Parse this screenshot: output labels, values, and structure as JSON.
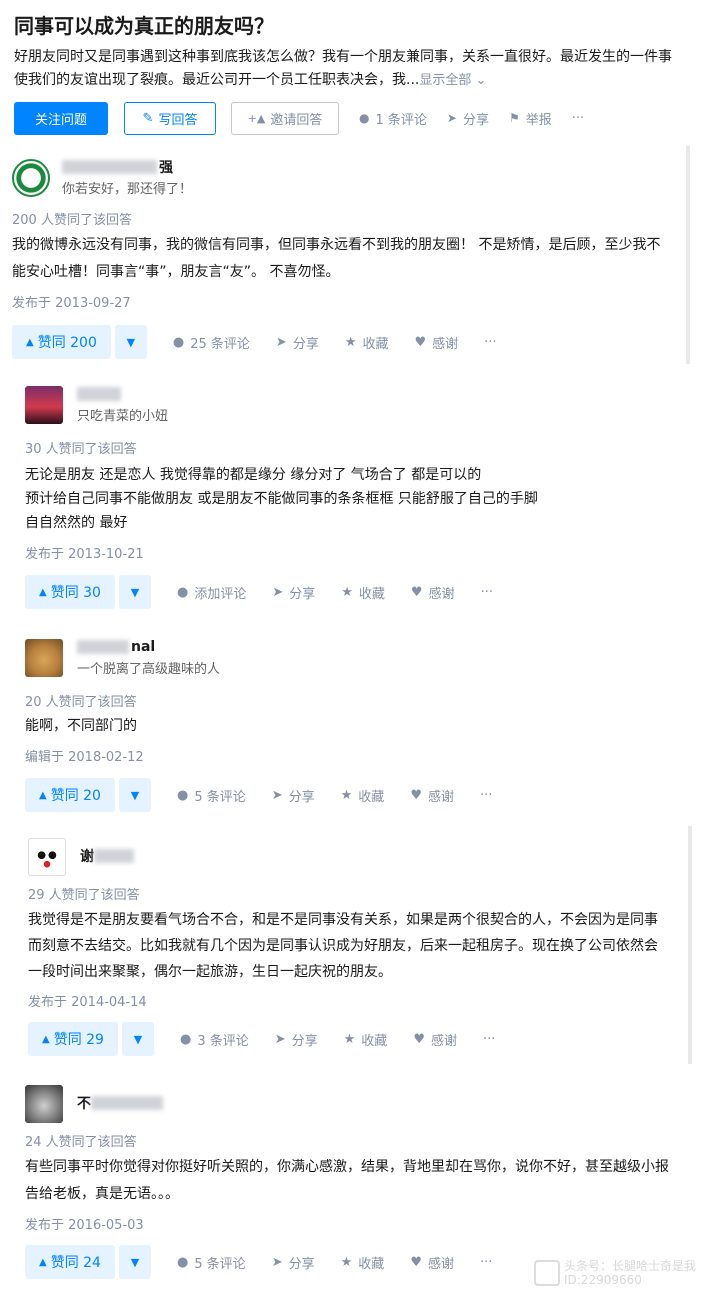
{
  "question": {
    "title": "同事可以成为真正的朋友吗？",
    "detail": "好朋友同时又是同事遇到这种事到底我该怎么做？我有一个朋友兼同事，关系一直很好。最近发生的一件事使我们的友谊出现了裂痕。最近公司开一个员工任职表决会，我...",
    "show_all": "显示全部 ⌄",
    "follow_label": "关注问题",
    "write_label": "写回答",
    "invite_label": "邀请回答",
    "comment_label": "1 条评论",
    "share_label": "分享",
    "report_label": "举报",
    "more_label": "···"
  },
  "answers": [
    {
      "name_visible": "强",
      "bio": "你若安好，那还得了！",
      "votes_text": "200 人赞同了该回答",
      "content": [
        "我的微博永远没有同事，我的微信有同事，但同事永远看不到我的朋友圈！ 不是矫情，是后顾，至少我不能安心吐槽！同事言“事”，朋友言“友”。 不喜勿怪。"
      ],
      "date": "发布于 2013-09-27",
      "vote_label": "赞同 200",
      "comment_label": "25 条评论",
      "share_label": "分享",
      "fav_label": "收藏",
      "thanks_label": "感谢",
      "more_label": "···"
    },
    {
      "name_visible": "",
      "bio": "只吃青菜的小妞",
      "votes_text": "30 人赞同了该回答",
      "content": [
        "无论是朋友 还是恋人 我觉得靠的都是缘分 缘分对了 气场合了 都是可以的",
        "预计给自己同事不能做朋友 或是朋友不能做同事的条条框框 只能舒服了自己的手脚",
        "自自然然的 最好"
      ],
      "date": "发布于 2013-10-21",
      "vote_label": "赞同 30",
      "comment_label": "添加评论",
      "share_label": "分享",
      "fav_label": "收藏",
      "thanks_label": "感谢",
      "more_label": "···"
    },
    {
      "name_visible": "nal",
      "bio": "一个脱离了高级趣味的人",
      "votes_text": "20 人赞同了该回答",
      "content": [
        "能啊，不同部门的"
      ],
      "date": "编辑于 2018-02-12",
      "vote_label": "赞同 20",
      "comment_label": "5 条评论",
      "share_label": "分享",
      "fav_label": "收藏",
      "thanks_label": "感谢",
      "more_label": "···"
    },
    {
      "name_visible": "谢",
      "bio": "",
      "votes_text": "29 人赞同了该回答",
      "content": [
        "我觉得是不是朋友要看气场合不合，和是不是同事没有关系，如果是两个很契合的人，不会因为是同事而刻意不去结交。比如我就有几个因为是同事认识成为好朋友，后来一起租房子。现在换了公司依然会一段时间出来聚聚，偶尔一起旅游，生日一起庆祝的朋友。"
      ],
      "date": "发布于 2014-04-14",
      "vote_label": "赞同 29",
      "comment_label": "3 条评论",
      "share_label": "分享",
      "fav_label": "收藏",
      "thanks_label": "感谢",
      "more_label": "···"
    },
    {
      "name_visible": "不",
      "bio": "",
      "votes_text": "24 人赞同了该回答",
      "content": [
        "有些同事平时你觉得对你挺好听关照的，你满心感激，结果，背地里却在骂你，说你不好，甚至越级小报告给老板，真是无语。。。"
      ],
      "date": "发布于 2016-05-03",
      "vote_label": "赞同 24",
      "comment_label": "5 条评论",
      "share_label": "分享",
      "fav_label": "收藏",
      "thanks_label": "感谢",
      "more_label": "···"
    }
  ],
  "watermark": {
    "line1": "头条号：长腿哈士奇是我",
    "line2": "ID:22909660"
  },
  "icons": [
    "pen-icon",
    "invite-icon",
    "comment-icon",
    "share-icon",
    "flag-icon",
    "star-icon",
    "heart-icon"
  ],
  "colors": {
    "accent": "#0084ff",
    "meta": "#8590a6",
    "vote_bg": "#e5f2ff"
  }
}
